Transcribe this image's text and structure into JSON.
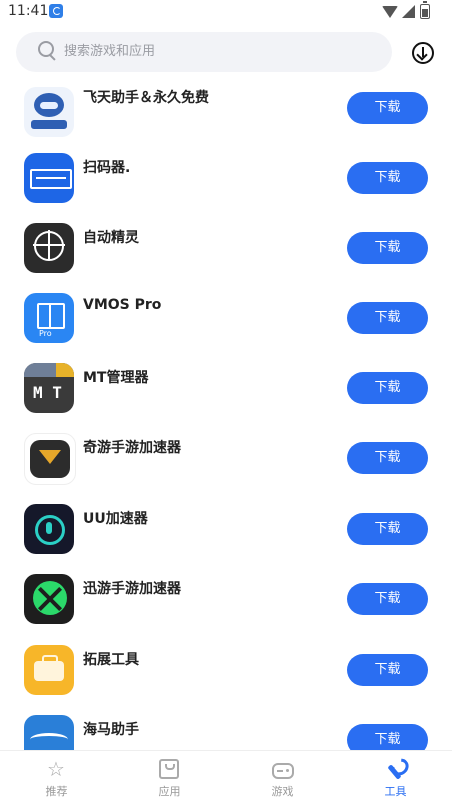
{
  "status_bar": {
    "time": "11:41"
  },
  "search": {
    "placeholder": "搜索游戏和应用"
  },
  "apps": [
    {
      "name": "飞天助手＆永久免费",
      "button": "下载",
      "icon": "feitian-app-icon"
    },
    {
      "name": "扫码器.",
      "button": "下载",
      "icon": "scanner-app-icon"
    },
    {
      "name": "自动精灵",
      "button": "下载",
      "icon": "auto-sprite-app-icon"
    },
    {
      "name": "VMOS Pro",
      "button": "下载",
      "icon": "vmos-app-icon"
    },
    {
      "name": "MT管理器",
      "button": "下载",
      "icon": "mt-manager-app-icon"
    },
    {
      "name": "奇游手游加速器",
      "button": "下载",
      "icon": "qiyou-app-icon"
    },
    {
      "name": "UU加速器",
      "button": "下载",
      "icon": "uu-app-icon"
    },
    {
      "name": "迅游手游加速器",
      "button": "下载",
      "icon": "xunyou-app-icon"
    },
    {
      "name": "拓展工具",
      "button": "下载",
      "icon": "toolbox-app-icon"
    },
    {
      "name": "海马助手",
      "button": "下载",
      "icon": "haima-app-icon"
    }
  ],
  "nav": [
    {
      "label": "推荐",
      "icon": "star-icon",
      "active": false
    },
    {
      "label": "应用",
      "icon": "bag-icon",
      "active": false
    },
    {
      "label": "游戏",
      "icon": "gamepad-icon",
      "active": false
    },
    {
      "label": "工具",
      "icon": "wrench-icon",
      "active": true
    }
  ],
  "colors": {
    "accent": "#2a6ef2",
    "search_bg": "#f2f3f7",
    "nav_inactive": "#999999"
  }
}
